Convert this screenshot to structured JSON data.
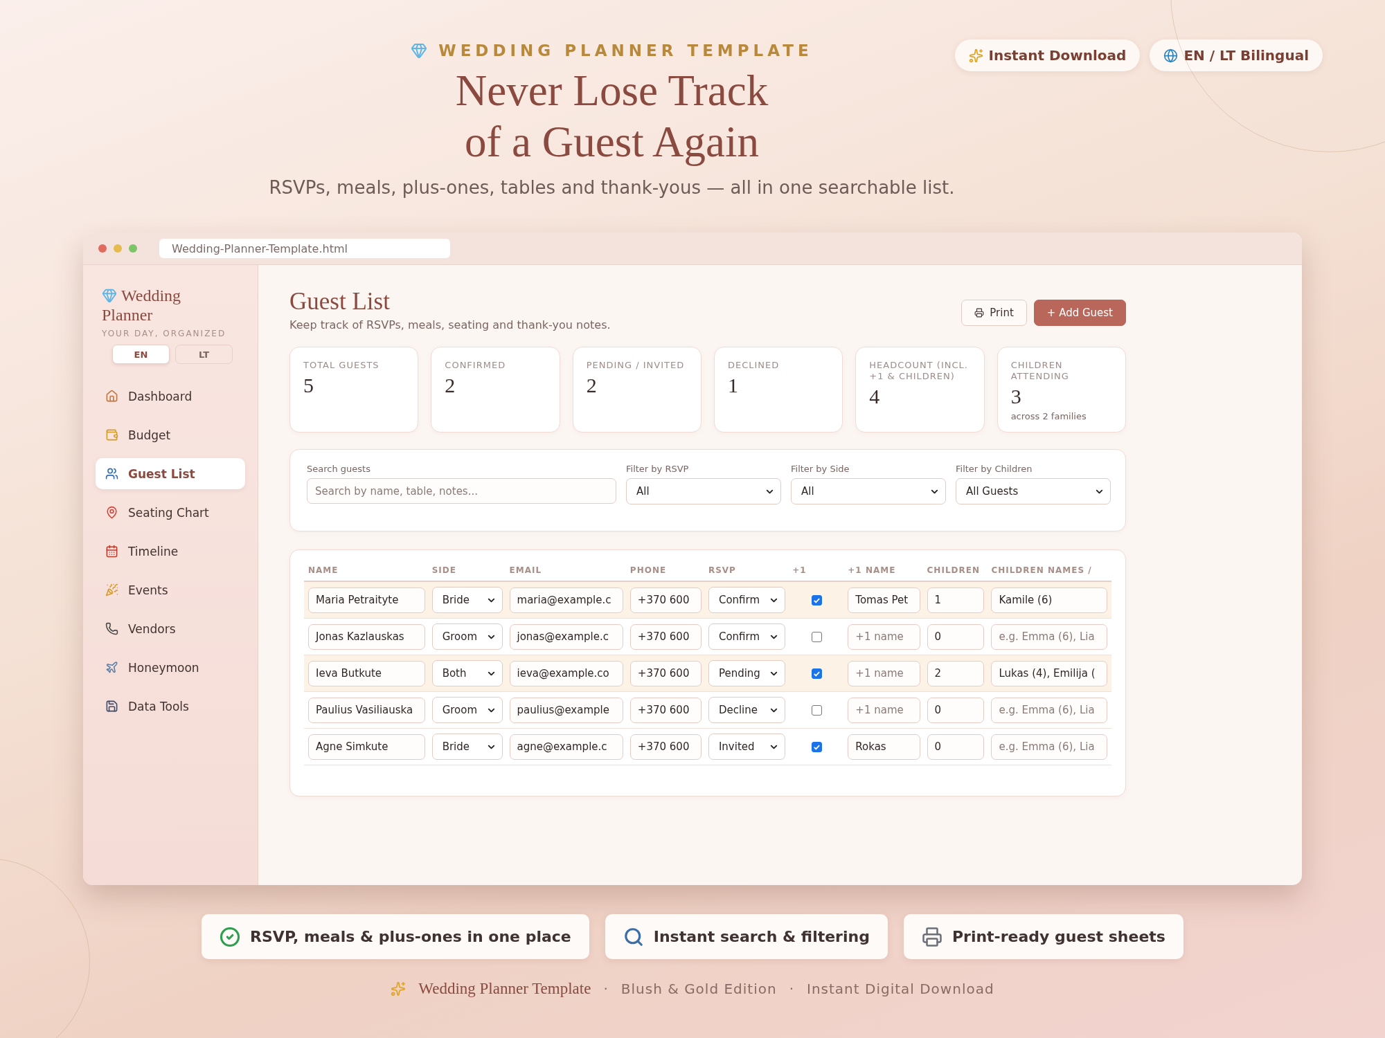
{
  "hero": {
    "eyebrow": "WEDDING PLANNER TEMPLATE",
    "title_lines": [
      "Never Lose Track",
      "of a Guest Again"
    ],
    "subtitle": "RSVPs, meals, plus-ones, tables and thank-yous — all in one searchable list."
  },
  "badges": [
    {
      "label": "Instant Download",
      "kind": "sparkles"
    },
    {
      "label": "EN / LT Bilingual",
      "kind": "globe"
    }
  ],
  "window": {
    "url": "Wedding-Planner-Template.html"
  },
  "sidebar": {
    "brand": "Wedding Planner",
    "tagline": "YOUR DAY, ORGANIZED",
    "languages": [
      {
        "label": "EN",
        "selected": true
      },
      {
        "label": "LT",
        "selected": false
      }
    ],
    "items": [
      {
        "label": "Dashboard",
        "kind": "home",
        "selected": false
      },
      {
        "label": "Budget",
        "kind": "budget",
        "selected": false
      },
      {
        "label": "Guest List",
        "kind": "guests",
        "selected": true
      },
      {
        "label": "Seating Chart",
        "kind": "pin",
        "selected": false
      },
      {
        "label": "Timeline",
        "kind": "calendar",
        "selected": false
      },
      {
        "label": "Events",
        "kind": "party",
        "selected": false
      },
      {
        "label": "Vendors",
        "kind": "phone",
        "selected": false
      },
      {
        "label": "Honeymoon",
        "kind": "plane",
        "selected": false
      },
      {
        "label": "Data Tools",
        "kind": "save",
        "selected": false
      }
    ]
  },
  "page": {
    "title": "Guest List",
    "subtitle": "Keep track of RSVPs, meals, seating and thank-you notes.",
    "buttons": [
      {
        "label": "Print",
        "kind": "secondary"
      },
      {
        "label": "+ Add Guest",
        "kind": "primary"
      }
    ]
  },
  "stats": [
    {
      "label": "TOTAL GUESTS",
      "value": "5"
    },
    {
      "label": "CONFIRMED",
      "value": "2"
    },
    {
      "label": "PENDING / INVITED",
      "value": "2"
    },
    {
      "label": "DECLINED",
      "value": "1"
    },
    {
      "label": "HEADCOUNT (INCL. +1 & CHILDREN)",
      "value": "4"
    },
    {
      "label": "CHILDREN ATTENDING",
      "value": "3",
      "note": "across 2 families"
    }
  ],
  "filters": {
    "search": {
      "label": "Search guests",
      "placeholder": "Search by name, table, notes..."
    },
    "selects": [
      {
        "label": "Filter by RSVP",
        "value": "All"
      },
      {
        "label": "Filter by Side",
        "value": "All"
      },
      {
        "label": "Filter by Children",
        "value": "All Guests"
      }
    ]
  },
  "table": {
    "columns": [
      "NAME",
      "SIDE",
      "EMAIL",
      "PHONE",
      "RSVP",
      "+1",
      "+1 NAME",
      "CHILDREN",
      "CHILDREN NAMES /"
    ],
    "rows": [
      {
        "highlighted": true,
        "name": "Maria Petraityte",
        "side": "Bride",
        "email": "maria@example.c",
        "phone": "+370 600",
        "rsvp": "Confirm",
        "plus_one": true,
        "plus_one_name": {
          "value": "Tomas Pet"
        },
        "children": "1",
        "children_names": {
          "value": "Kamile (6)"
        }
      },
      {
        "highlighted": false,
        "name": "Jonas Kazlauskas",
        "side": "Groom",
        "email": "jonas@example.c",
        "phone": "+370 600",
        "rsvp": "Confirm",
        "plus_one": false,
        "plus_one_name": {
          "placeholder": "+1 name"
        },
        "children": "0",
        "children_names": {
          "placeholder": "e.g. Emma (6), Lia"
        }
      },
      {
        "highlighted": true,
        "name": "Ieva Butkute",
        "side": "Both",
        "email": "ieva@example.co",
        "phone": "+370 600",
        "rsvp": "Pending",
        "plus_one": true,
        "plus_one_name": {
          "placeholder": "+1 name"
        },
        "children": "2",
        "children_names": {
          "value": "Lukas (4), Emilija ("
        }
      },
      {
        "highlighted": false,
        "name": "Paulius Vasiliauska",
        "side": "Groom",
        "email": "paulius@example",
        "phone": "+370 600",
        "rsvp": "Decline",
        "plus_one": false,
        "plus_one_name": {
          "placeholder": "+1 name"
        },
        "children": "0",
        "children_names": {
          "placeholder": "e.g. Emma (6), Lia"
        }
      },
      {
        "highlighted": false,
        "name": "Agne Simkute",
        "side": "Bride",
        "email": "agne@example.c",
        "phone": "+370 600",
        "rsvp": "Invited",
        "plus_one": true,
        "plus_one_name": {
          "value": "Rokas"
        },
        "children": "0",
        "children_names": {
          "placeholder": "e.g. Emma (6), Lia"
        }
      }
    ]
  },
  "features": [
    {
      "label": "RSVP, meals & plus-ones in one place",
      "kind": "check"
    },
    {
      "label": "Instant search & filtering",
      "kind": "search"
    },
    {
      "label": "Print-ready guest sheets",
      "kind": "printer"
    }
  ],
  "footer": {
    "brand": "Wedding Planner Template",
    "separator": "·",
    "items": [
      "Blush & Gold Edition",
      "Instant Digital Download"
    ]
  }
}
